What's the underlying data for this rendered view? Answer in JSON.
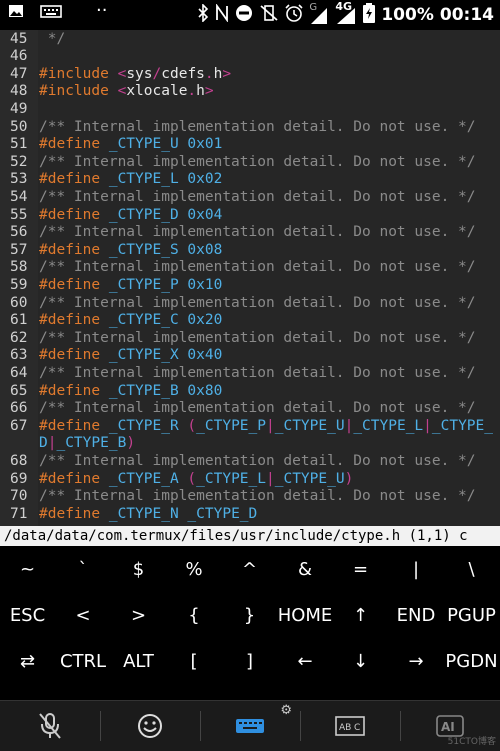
{
  "status_bar": {
    "battery": "100%",
    "time": "00:14",
    "network": "4G",
    "signal_letter": "G"
  },
  "editor": {
    "lines": [
      {
        "num": "45",
        "tokens": [
          {
            "t": " */",
            "c": "cm"
          }
        ]
      },
      {
        "num": "46",
        "tokens": []
      },
      {
        "num": "47",
        "tokens": [
          {
            "t": "#include",
            "c": "kw"
          },
          {
            "t": " ",
            "c": ""
          },
          {
            "t": "<",
            "c": "op"
          },
          {
            "t": "sys",
            "c": ""
          },
          {
            "t": "/",
            "c": "op"
          },
          {
            "t": "cdefs",
            "c": ""
          },
          {
            "t": ".",
            "c": "op"
          },
          {
            "t": "h",
            "c": ""
          },
          {
            "t": ">",
            "c": "op"
          }
        ]
      },
      {
        "num": "48",
        "tokens": [
          {
            "t": "#include",
            "c": "kw"
          },
          {
            "t": " ",
            "c": ""
          },
          {
            "t": "<",
            "c": "op"
          },
          {
            "t": "xlocale",
            "c": ""
          },
          {
            "t": ".",
            "c": "op"
          },
          {
            "t": "h",
            "c": ""
          },
          {
            "t": ">",
            "c": "op"
          }
        ]
      },
      {
        "num": "49",
        "tokens": []
      },
      {
        "num": "50",
        "tokens": [
          {
            "t": "/** Internal implementation detail. Do not use. */",
            "c": "cm"
          }
        ]
      },
      {
        "num": "51",
        "tokens": [
          {
            "t": "#define",
            "c": "kw"
          },
          {
            "t": " _CTYPE_U ",
            "c": "mac"
          },
          {
            "t": "0x01",
            "c": "num"
          }
        ]
      },
      {
        "num": "52",
        "tokens": [
          {
            "t": "/** Internal implementation detail. Do not use. */",
            "c": "cm"
          }
        ]
      },
      {
        "num": "53",
        "tokens": [
          {
            "t": "#define",
            "c": "kw"
          },
          {
            "t": " _CTYPE_L ",
            "c": "mac"
          },
          {
            "t": "0x02",
            "c": "num"
          }
        ]
      },
      {
        "num": "54",
        "tokens": [
          {
            "t": "/** Internal implementation detail. Do not use. */",
            "c": "cm"
          }
        ]
      },
      {
        "num": "55",
        "tokens": [
          {
            "t": "#define",
            "c": "kw"
          },
          {
            "t": " _CTYPE_D ",
            "c": "mac"
          },
          {
            "t": "0x04",
            "c": "num"
          }
        ]
      },
      {
        "num": "56",
        "tokens": [
          {
            "t": "/** Internal implementation detail. Do not use. */",
            "c": "cm"
          }
        ]
      },
      {
        "num": "57",
        "tokens": [
          {
            "t": "#define",
            "c": "kw"
          },
          {
            "t": " _CTYPE_S ",
            "c": "mac"
          },
          {
            "t": "0x08",
            "c": "num"
          }
        ]
      },
      {
        "num": "58",
        "tokens": [
          {
            "t": "/** Internal implementation detail. Do not use. */",
            "c": "cm"
          }
        ]
      },
      {
        "num": "59",
        "tokens": [
          {
            "t": "#define",
            "c": "kw"
          },
          {
            "t": " _CTYPE_P ",
            "c": "mac"
          },
          {
            "t": "0x10",
            "c": "num"
          }
        ]
      },
      {
        "num": "60",
        "tokens": [
          {
            "t": "/** Internal implementation detail. Do not use. */",
            "c": "cm"
          }
        ]
      },
      {
        "num": "61",
        "tokens": [
          {
            "t": "#define",
            "c": "kw"
          },
          {
            "t": " _CTYPE_C ",
            "c": "mac"
          },
          {
            "t": "0x20",
            "c": "num"
          }
        ]
      },
      {
        "num": "62",
        "tokens": [
          {
            "t": "/** Internal implementation detail. Do not use. */",
            "c": "cm"
          }
        ]
      },
      {
        "num": "63",
        "tokens": [
          {
            "t": "#define",
            "c": "kw"
          },
          {
            "t": " _CTYPE_X ",
            "c": "mac"
          },
          {
            "t": "0x40",
            "c": "num"
          }
        ]
      },
      {
        "num": "64",
        "tokens": [
          {
            "t": "/** Internal implementation detail. Do not use. */",
            "c": "cm"
          }
        ]
      },
      {
        "num": "65",
        "tokens": [
          {
            "t": "#define",
            "c": "kw"
          },
          {
            "t": " _CTYPE_B ",
            "c": "mac"
          },
          {
            "t": "0x80",
            "c": "num"
          }
        ]
      },
      {
        "num": "66",
        "tokens": [
          {
            "t": "/** Internal implementation detail. Do not use. */",
            "c": "cm"
          }
        ]
      },
      {
        "num": "67",
        "tokens": [
          {
            "t": "#define",
            "c": "kw"
          },
          {
            "t": " _CTYPE_R ",
            "c": "mac"
          },
          {
            "t": "(",
            "c": "op"
          },
          {
            "t": "_CTYPE_P",
            "c": "mac"
          },
          {
            "t": "|",
            "c": "op"
          },
          {
            "t": "_CTYPE_U",
            "c": "mac"
          },
          {
            "t": "|",
            "c": "op"
          },
          {
            "t": "_CTYPE_L",
            "c": "mac"
          },
          {
            "t": "|",
            "c": "op"
          },
          {
            "t": "_CTYPE_",
            "c": "mac"
          }
        ]
      },
      {
        "num": "",
        "tokens": [
          {
            "t": "D",
            "c": "mac"
          },
          {
            "t": "|",
            "c": "op"
          },
          {
            "t": "_CTYPE_B",
            "c": "mac"
          },
          {
            "t": ")",
            "c": "op"
          }
        ]
      },
      {
        "num": "68",
        "tokens": [
          {
            "t": "/** Internal implementation detail. Do not use. */",
            "c": "cm"
          }
        ]
      },
      {
        "num": "69",
        "tokens": [
          {
            "t": "#define",
            "c": "kw"
          },
          {
            "t": " _CTYPE_A ",
            "c": "mac"
          },
          {
            "t": "(",
            "c": "op"
          },
          {
            "t": "_CTYPE_L",
            "c": "mac"
          },
          {
            "t": "|",
            "c": "op"
          },
          {
            "t": "_CTYPE_U",
            "c": "mac"
          },
          {
            "t": ")",
            "c": "op"
          }
        ]
      },
      {
        "num": "70",
        "tokens": [
          {
            "t": "/** Internal implementation detail. Do not use. */",
            "c": "cm"
          }
        ]
      },
      {
        "num": "71",
        "tokens": [
          {
            "t": "#define",
            "c": "kw"
          },
          {
            "t": " _CTYPE_N ",
            "c": "mac"
          },
          {
            "t": "_CTYPE_D",
            "c": "mac"
          }
        ]
      }
    ]
  },
  "status_line": "/data/data/com.termux/files/usr/include/ctype.h (1,1) c",
  "extra_keys": {
    "row1": [
      "~",
      "`",
      "$",
      "%",
      "^",
      "&",
      "=",
      "|",
      "\\"
    ],
    "row2": [
      "ESC",
      "<",
      ">",
      "{",
      "}",
      "HOME",
      "↑",
      "END",
      "PGUP"
    ],
    "row3": [
      "⇄",
      "CTRL",
      "ALT",
      "[",
      "]",
      "←",
      "↓",
      "→",
      "PGDN"
    ]
  },
  "watermark": "51CTO博客",
  "colors": {
    "keyword": "#e07a2e",
    "comment": "#8a8a8a",
    "macro": "#4fb0e6",
    "operator": "#c2408f",
    "keyboard_accent": "#2f8fe0"
  }
}
